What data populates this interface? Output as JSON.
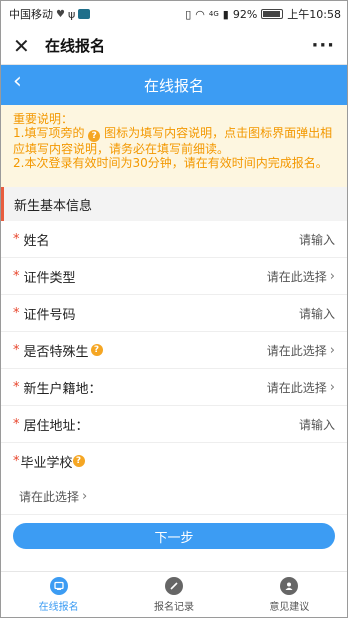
{
  "status_bar": {
    "carrier": "中国移动",
    "network": "4G",
    "battery": "92%",
    "time": "上午10:58"
  },
  "app_bar": {
    "title": "在线报名",
    "close_icon": "close-icon",
    "more_icon": "more-icon"
  },
  "header": {
    "title": "在线报名",
    "back_icon": "back-chevron-icon"
  },
  "notice": {
    "title": "重要说明：",
    "line1_a": "1.填写项旁的",
    "line1_b": "图标为填写内容说明，点击图标界面弹出相应填写内容说明，请务必在填写前细读。",
    "line2": "2.本次登录有效时间为30分钟，请在有效时间内完成报名。"
  },
  "section": {
    "title": "新生基本信息"
  },
  "form": {
    "rows": [
      {
        "label": "姓名",
        "value": "请输入",
        "chevron": ""
      },
      {
        "label": "证件类型",
        "value": "请在此选择",
        "chevron": "›"
      },
      {
        "label": "证件号码",
        "value": "请输入",
        "chevron": ""
      },
      {
        "label": "是否特殊生",
        "value": "请在此选择",
        "chevron": "›"
      },
      {
        "label": "新生户籍地：",
        "value": "请在此选择",
        "chevron": "›"
      },
      {
        "label": "居住地址：",
        "value": "请输入",
        "chevron": ""
      }
    ],
    "school_label": "毕业学校",
    "school_value": "请在此选择",
    "school_chevron": "›",
    "required_mark": "*",
    "help_mark": "?"
  },
  "next_button": "下一步",
  "tabs": [
    {
      "label": "在线报名",
      "icon": "register-icon",
      "active": true
    },
    {
      "label": "报名记录",
      "icon": "record-icon",
      "active": false
    },
    {
      "label": "意见建议",
      "icon": "feedback-icon",
      "active": false
    }
  ],
  "colors": {
    "primary": "#3c9cf3",
    "notice_text": "#f39800",
    "notice_bg": "#fdf6e0",
    "required": "#e8452c"
  }
}
